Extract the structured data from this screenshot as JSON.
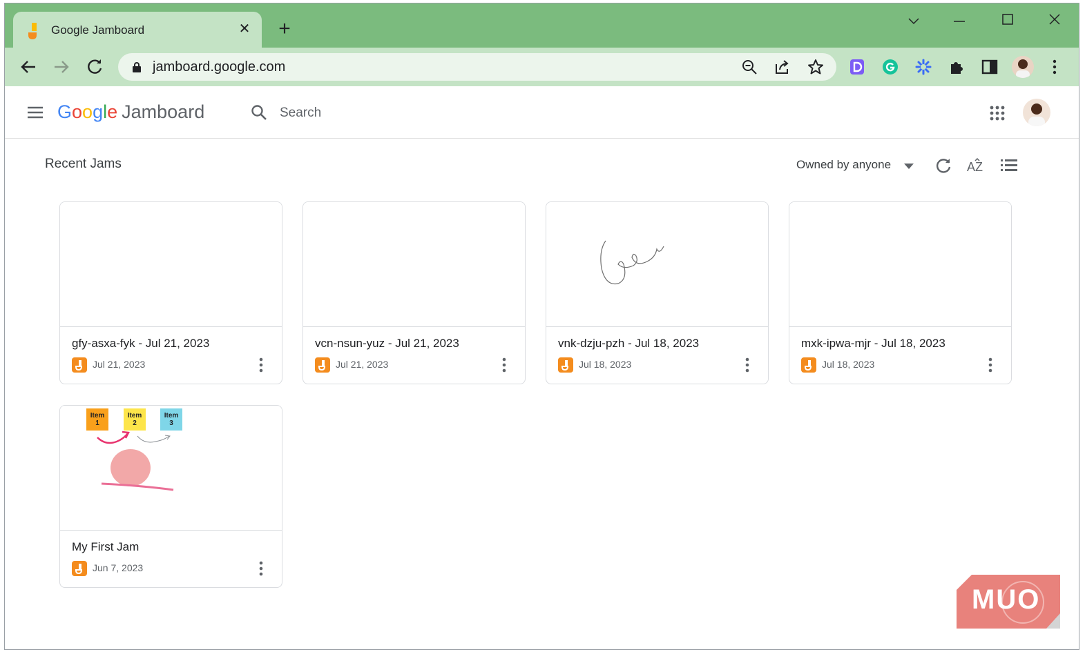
{
  "browser": {
    "tab_title": "Google Jamboard",
    "url": "jamboard.google.com"
  },
  "app": {
    "logo_letters": [
      "G",
      "o",
      "o",
      "g",
      "l",
      "e"
    ],
    "product": "Jamboard",
    "search_placeholder": "Search"
  },
  "recent": {
    "title": "Recent Jams",
    "owner_filter": "Owned by anyone"
  },
  "jams": [
    {
      "title": "gfy-asxa-fyk - Jul 21, 2023",
      "date": "Jul 21, 2023"
    },
    {
      "title": "vcn-nsun-yuz - Jul 21, 2023",
      "date": "Jul 21, 2023"
    },
    {
      "title": "vnk-dzju-pzh - Jul 18, 2023",
      "date": "Jul 18, 2023"
    },
    {
      "title": "mxk-ipwa-mjr - Jul 18, 2023",
      "date": "Jul 18, 2023"
    },
    {
      "title": "My First Jam",
      "date": "Jun 7, 2023"
    }
  ],
  "first_jam_thumb": {
    "stickies": [
      {
        "line1": "Item",
        "line2": "1",
        "color": "#f9a01b"
      },
      {
        "line1": "Item",
        "line2": "2",
        "color": "#fde54a"
      },
      {
        "line1": "Item",
        "line2": "3",
        "color": "#7fd6e8"
      }
    ]
  },
  "watermark": "MUO",
  "colors": {
    "titlebar": "#7bbb7e",
    "toolbar": "#c4e3c5",
    "jam_icon": "#f48c1e"
  }
}
